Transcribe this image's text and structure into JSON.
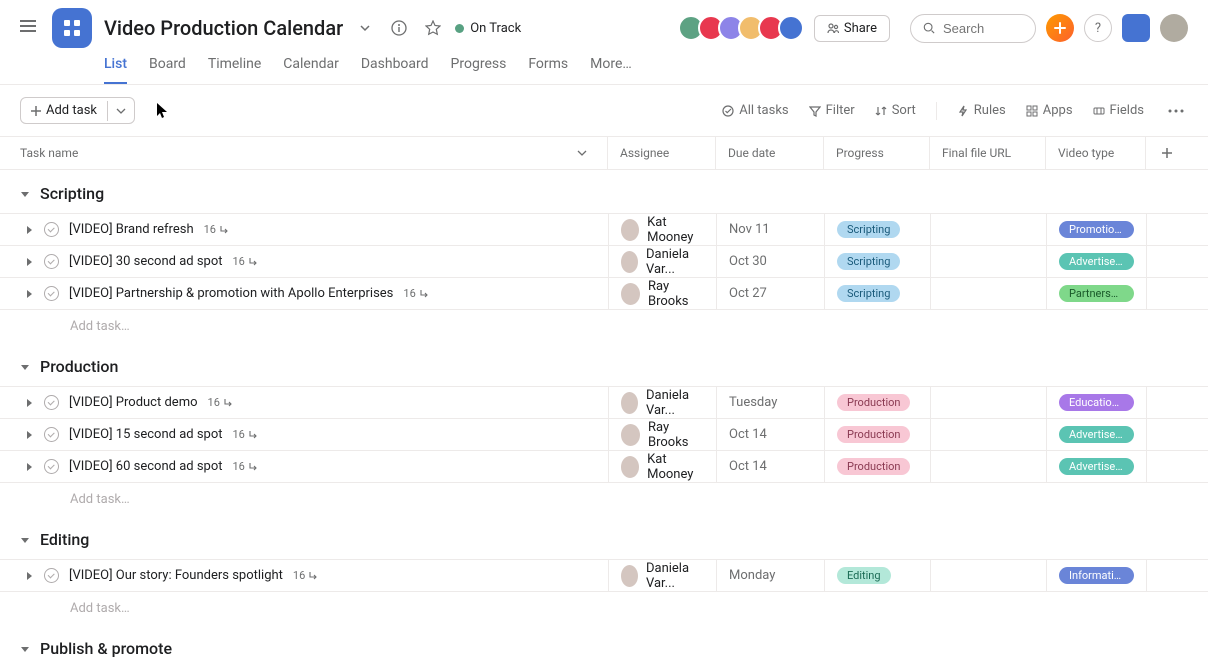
{
  "project": {
    "title": "Video Production Calendar",
    "status": "On Track"
  },
  "tabs": [
    "List",
    "Board",
    "Timeline",
    "Calendar",
    "Dashboard",
    "Progress",
    "Forms",
    "More…"
  ],
  "active_tab": 0,
  "share_label": "Share",
  "search_placeholder": "Search",
  "add_task_label": "Add task",
  "toolbar": {
    "all_tasks": "All tasks",
    "filter": "Filter",
    "sort": "Sort",
    "rules": "Rules",
    "apps": "Apps",
    "fields": "Fields"
  },
  "columns": {
    "name": "Task name",
    "assignee": "Assignee",
    "due": "Due date",
    "progress": "Progress",
    "file": "Final file URL",
    "type": "Video type"
  },
  "add_task_placeholder": "Add task…",
  "sections": [
    {
      "title": "Scripting",
      "tasks": [
        {
          "title": "[VIDEO] Brand refresh",
          "subtasks": "16",
          "assignee": "Kat Mooney",
          "due": "Nov 11",
          "progress": "Scripting",
          "progress_class": "scripting",
          "type": "Promotional",
          "type_class": "promo"
        },
        {
          "title": "[VIDEO] 30 second ad spot",
          "subtasks": "16",
          "assignee": "Daniela Var...",
          "due": "Oct 30",
          "progress": "Scripting",
          "progress_class": "scripting",
          "type": "Advertisem...",
          "type_class": "advert"
        },
        {
          "title": "[VIDEO] Partnership & promotion with Apollo Enterprises",
          "subtasks": "16",
          "assignee": "Ray Brooks",
          "due": "Oct 27",
          "progress": "Scripting",
          "progress_class": "scripting",
          "type": "Partnership",
          "type_class": "partner"
        }
      ]
    },
    {
      "title": "Production",
      "tasks": [
        {
          "title": "[VIDEO] Product demo",
          "subtasks": "16",
          "assignee": "Daniela Var...",
          "due": "Tuesday",
          "progress": "Production",
          "progress_class": "production",
          "type": "Educational",
          "type_class": "edu"
        },
        {
          "title": "[VIDEO] 15 second ad spot",
          "subtasks": "16",
          "assignee": "Ray Brooks",
          "due": "Oct 14",
          "progress": "Production",
          "progress_class": "production",
          "type": "Advertisem...",
          "type_class": "advert"
        },
        {
          "title": "[VIDEO] 60 second ad spot",
          "subtasks": "16",
          "assignee": "Kat Mooney",
          "due": "Oct 14",
          "progress": "Production",
          "progress_class": "production",
          "type": "Advertisem...",
          "type_class": "advert"
        }
      ]
    },
    {
      "title": "Editing",
      "tasks": [
        {
          "title": "[VIDEO] Our story: Founders spotlight",
          "subtasks": "16",
          "assignee": "Daniela Var...",
          "due": "Monday",
          "progress": "Editing",
          "progress_class": "editing",
          "type": "Informational",
          "type_class": "info"
        }
      ]
    },
    {
      "title": "Publish & promote",
      "tasks": []
    }
  ]
}
